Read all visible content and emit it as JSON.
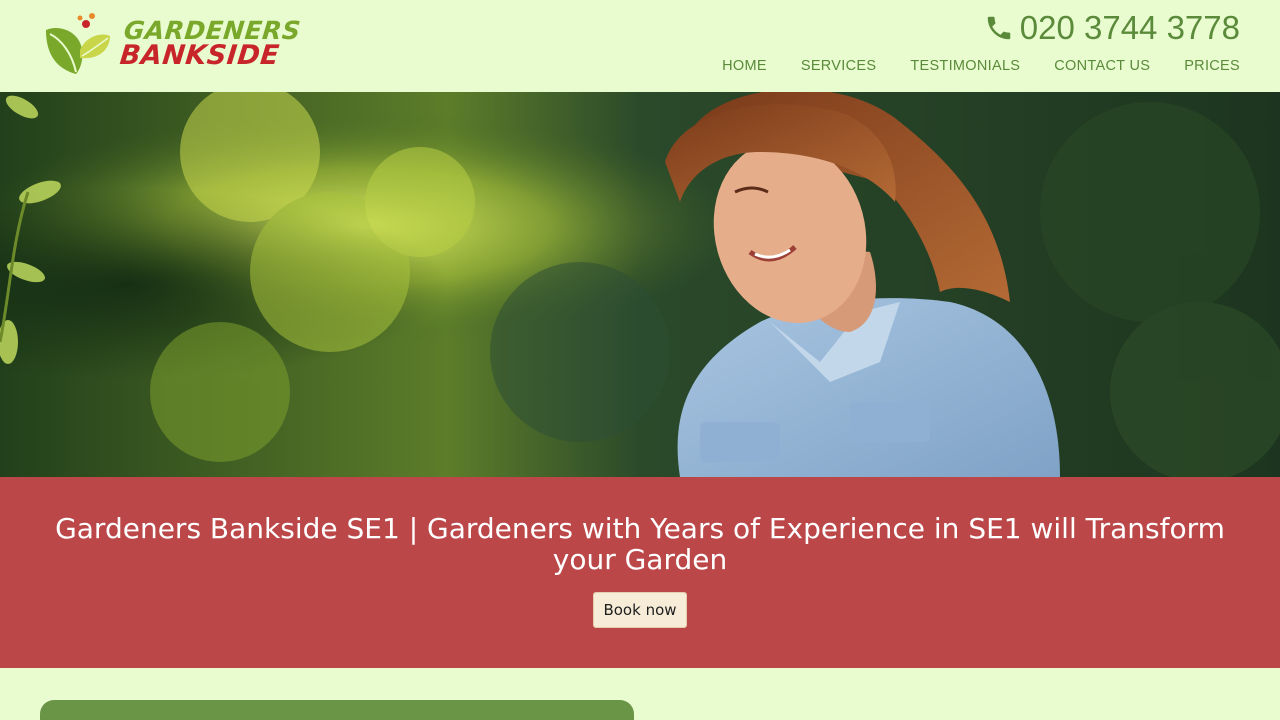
{
  "brand": {
    "line1": "GARDENERS",
    "line2": "BANKSIDE",
    "colors": {
      "green": "#7aa82b",
      "red": "#c8252a"
    }
  },
  "header": {
    "phone": "020 3744 3778",
    "phone_icon": "phone-icon"
  },
  "nav": {
    "items": [
      {
        "label": "HOME"
      },
      {
        "label": "SERVICES"
      },
      {
        "label": "TESTIMONIALS"
      },
      {
        "label": "CONTACT US"
      },
      {
        "label": "PRICES"
      }
    ]
  },
  "banner": {
    "title": "Gardeners Bankside SE1 | Gardeners with Years of Experience in SE1 will Transform your Garden",
    "button_label": "Book now",
    "background": "#bb4749"
  },
  "theme": {
    "page_bg": "#e9fcd0",
    "accent_green": "#5a8a3a",
    "card_green": "#6a9446"
  }
}
